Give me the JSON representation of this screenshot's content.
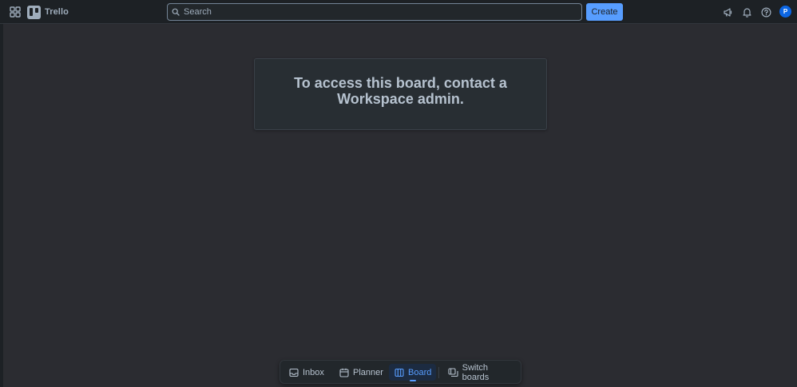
{
  "app": {
    "name": "Trello"
  },
  "header": {
    "search_placeholder": "Search",
    "create_label": "Create",
    "avatar_initial": "P",
    "icons": [
      "apps-switcher-icon",
      "megaphone-icon",
      "bell-icon",
      "help-icon"
    ]
  },
  "message": {
    "title": "To access this board, contact a Workspace admin."
  },
  "switcher": {
    "items": [
      {
        "label": "Inbox",
        "icon": "inbox-icon",
        "active": false
      },
      {
        "label": "Planner",
        "icon": "calendar-icon",
        "active": false
      },
      {
        "label": "Board",
        "icon": "board-icon",
        "active": true
      },
      {
        "label": "Switch boards",
        "icon": "switch-boards-icon",
        "active": false
      }
    ]
  },
  "colors": {
    "background": "#2b2c31",
    "topbar": "#1d2125",
    "accent": "#579dff",
    "text": "#b6c2cf"
  }
}
